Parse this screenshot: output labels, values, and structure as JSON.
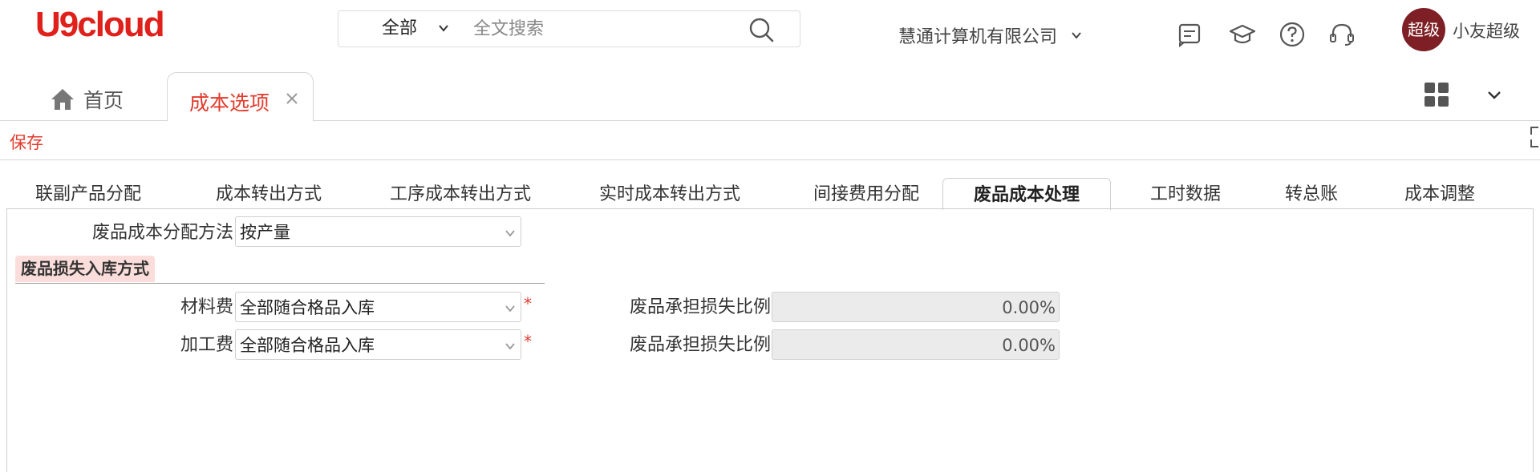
{
  "app": {
    "logo_text": "U9cloud",
    "brand_color": "#e0201a",
    "accent_color": "#e23b2d"
  },
  "search": {
    "scope": "全部",
    "placeholder": "全文搜索"
  },
  "header": {
    "company": "慧通计算机有限公司",
    "icons": [
      "message-icon",
      "academy-icon",
      "help-icon",
      "support-headset-icon"
    ],
    "avatar_text": "超级",
    "avatar_color": "#7d1f25",
    "user_name": "小友超级"
  },
  "page_tabs": {
    "home_label": "首页",
    "active_label": "成本选项"
  },
  "toolbar": {
    "save_label": "保存"
  },
  "sub_tabs": [
    {
      "label": "联副产品分配",
      "active": false
    },
    {
      "label": "成本转出方式",
      "active": false
    },
    {
      "label": "工序成本转出方式",
      "active": false
    },
    {
      "label": "实时成本转出方式",
      "active": false
    },
    {
      "label": "间接费用分配",
      "active": false
    },
    {
      "label": "废品成本处理",
      "active": true
    },
    {
      "label": "工时数据",
      "active": false
    },
    {
      "label": "转总账",
      "active": false
    },
    {
      "label": "成本调整",
      "active": false
    }
  ],
  "form": {
    "method_label": "废品成本分配方法",
    "method_value": "按产量",
    "section_title": "废品损失入库方式",
    "material_label": "材料费",
    "material_value": "全部随合格品入库",
    "processing_label": "加工费",
    "processing_value": "全部随合格品入库",
    "required_mark": "*",
    "ratio_label_1": "废品承担损失比例",
    "ratio_value_1": "0.00%",
    "ratio_label_2": "废品承担损失比例",
    "ratio_value_2": "0.00%"
  }
}
